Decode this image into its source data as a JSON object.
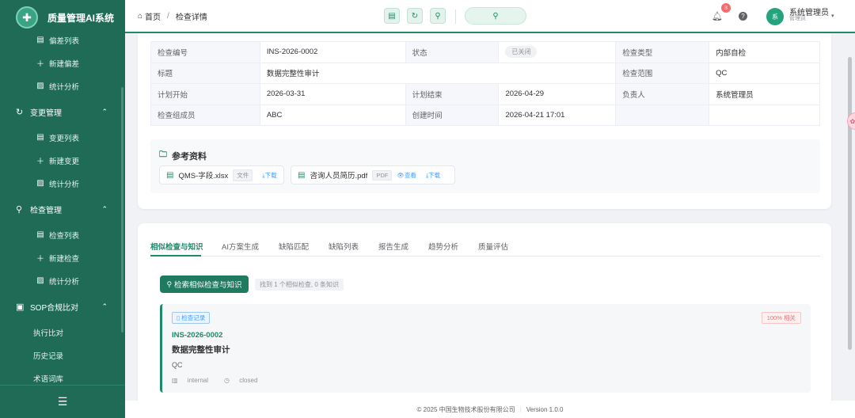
{
  "app": {
    "title": "质量管理AI系统"
  },
  "sidebar": {
    "items": [
      {
        "type": "sub",
        "icon": "list-icon",
        "glyph": "▤",
        "label": "偏差列表"
      },
      {
        "type": "sub",
        "icon": "plus-icon",
        "glyph": "＋",
        "label": "新建偏差"
      },
      {
        "type": "sub",
        "icon": "chart-icon",
        "glyph": "▨",
        "label": "统计分析"
      },
      {
        "type": "group",
        "icon": "refresh-icon",
        "glyph": "↻",
        "label": "变更管理",
        "chev": "⌃"
      },
      {
        "type": "sub",
        "icon": "list-icon",
        "glyph": "▤",
        "label": "变更列表"
      },
      {
        "type": "sub",
        "icon": "plus-icon",
        "glyph": "＋",
        "label": "新建变更"
      },
      {
        "type": "sub",
        "icon": "chart-icon",
        "glyph": "▨",
        "label": "统计分析"
      },
      {
        "type": "group",
        "icon": "search-icon",
        "glyph": "⚲",
        "label": "检查管理",
        "chev": "⌃"
      },
      {
        "type": "sub",
        "icon": "list-icon",
        "glyph": "▤",
        "label": "检查列表"
      },
      {
        "type": "sub",
        "icon": "plus-icon",
        "glyph": "＋",
        "label": "新建检查"
      },
      {
        "type": "sub",
        "icon": "chart-icon",
        "glyph": "▨",
        "label": "统计分析"
      },
      {
        "type": "group",
        "icon": "document-icon",
        "glyph": "▣",
        "label": "SOP合规比对",
        "chev": "⌃"
      },
      {
        "type": "plain",
        "label": "执行比对"
      },
      {
        "type": "plain",
        "label": "历史记录"
      },
      {
        "type": "plain",
        "label": "术语词库"
      }
    ],
    "footer_glyph": "☰"
  },
  "header": {
    "breadcrumb_home": "首页",
    "breadcrumb_sep": "/",
    "breadcrumb_current": "检查详情",
    "notification_count": "3",
    "help_glyph": "?",
    "avatar_text": "系",
    "user_name": "系统管理员",
    "user_role": "管理员"
  },
  "info": {
    "rows": [
      [
        {
          "l": "检查编号"
        },
        {
          "v": "INS-2026-0002"
        },
        {
          "l": "状态"
        },
        {
          "s": "已关闭"
        },
        {
          "l": "检查类型"
        },
        {
          "v": "内部自检"
        }
      ],
      [
        {
          "l": "标题"
        },
        {
          "v": "数据完整性审计",
          "span": 3
        },
        {
          "l": "检查范围"
        },
        {
          "v": "QC"
        }
      ],
      [
        {
          "l": "计划开始"
        },
        {
          "v": "2026-03-31"
        },
        {
          "l": "计划结束"
        },
        {
          "v": "2026-04-29"
        },
        {
          "l": "负责人"
        },
        {
          "v": "系统管理员"
        }
      ],
      [
        {
          "l": "检查组成员"
        },
        {
          "v": "ABC"
        },
        {
          "l": "创建时间"
        },
        {
          "v": "2026-04-21 17:01"
        },
        {
          "l": ""
        },
        {
          "v": ""
        }
      ]
    ]
  },
  "references": {
    "title": "参考资料",
    "files": [
      {
        "name": "QMS-字段.xlsx",
        "type": "文件",
        "download": "⤓下载"
      },
      {
        "name": "咨询人员简历.pdf",
        "type": "PDF",
        "view": "👁查看",
        "download": "⤓下载"
      }
    ]
  },
  "tabs": [
    {
      "label": "相似检查与知识",
      "active": true
    },
    {
      "label": "AI方案生成"
    },
    {
      "label": "缺陷匹配"
    },
    {
      "label": "缺陷列表"
    },
    {
      "label": "报告生成"
    },
    {
      "label": "趋势分析"
    },
    {
      "label": "质量评估"
    }
  ],
  "similar": {
    "search_button": "检索相似检查与知识",
    "found_text": "找到 1 个相似检查, 0 条知识",
    "result": {
      "tag": "检查记录",
      "relevance": "100% 相关",
      "id": "INS-2026-0002",
      "title": "数据完整性审计",
      "scope": "QC",
      "source": "internal",
      "status": "closed"
    }
  },
  "footer": {
    "copyright": "© 2025 中国生物技术股份有限公司",
    "sep": "|",
    "version": "Version 1.0.0"
  }
}
